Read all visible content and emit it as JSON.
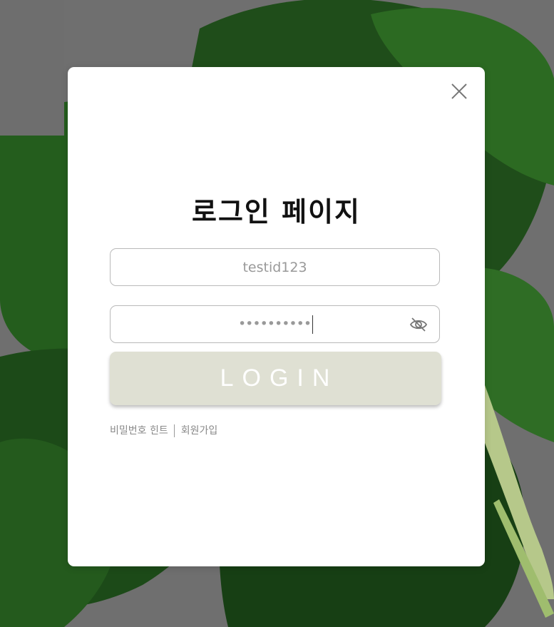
{
  "modal": {
    "title": "로그인 페이지",
    "close_icon": "close-icon"
  },
  "form": {
    "id_value": "testid123",
    "password_masked": "••••••••••",
    "eye_icon": "eye-off-icon",
    "login_label": "LOGIN"
  },
  "links": {
    "hint": "비밀번호 힌트",
    "signup": "회원가입"
  },
  "colors": {
    "login_bg": "#dfe0d3",
    "backdrop": "#6b6b6b"
  }
}
